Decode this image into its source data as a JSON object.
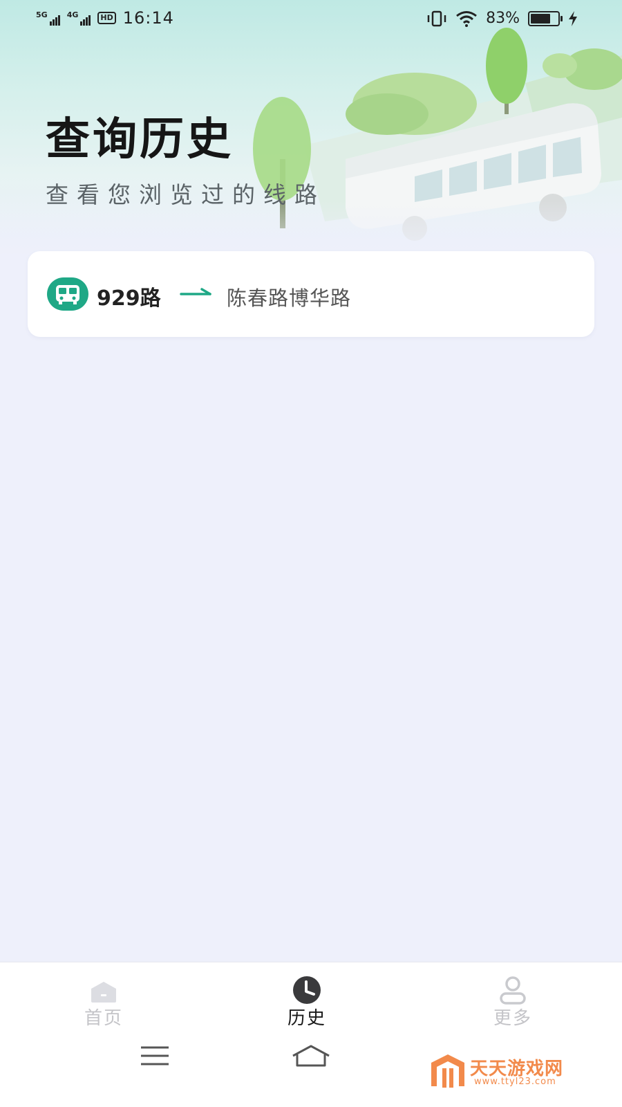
{
  "status_bar": {
    "network_1": "5G",
    "network_2": "4G",
    "hd_badge": "HD",
    "time": "16:14",
    "battery_percent": "83%",
    "battery_level": 0.83,
    "icons": [
      "signal-icon",
      "hd-voice-icon",
      "vibrate-icon",
      "wifi-icon",
      "battery-icon",
      "charging-icon"
    ]
  },
  "header": {
    "title": "查询历史",
    "subtitle": "查看您浏览过的线路"
  },
  "history": [
    {
      "route": "929路",
      "destination": "陈春路博华路",
      "icon": "bus-icon"
    }
  ],
  "tabs": [
    {
      "label": "首页",
      "icon": "home-icon",
      "active": false
    },
    {
      "label": "历史",
      "icon": "clock-icon",
      "active": true
    },
    {
      "label": "更多",
      "icon": "person-icon",
      "active": false
    }
  ],
  "nav_bar": {
    "icons": [
      "menu-icon",
      "home-nav-icon"
    ]
  },
  "watermark": {
    "name": "天天游戏网",
    "url": "www.ttyl23.com"
  },
  "colors": {
    "accent": "#1fa886",
    "background": "#eef0fb",
    "watermark": "#f28a4b"
  }
}
